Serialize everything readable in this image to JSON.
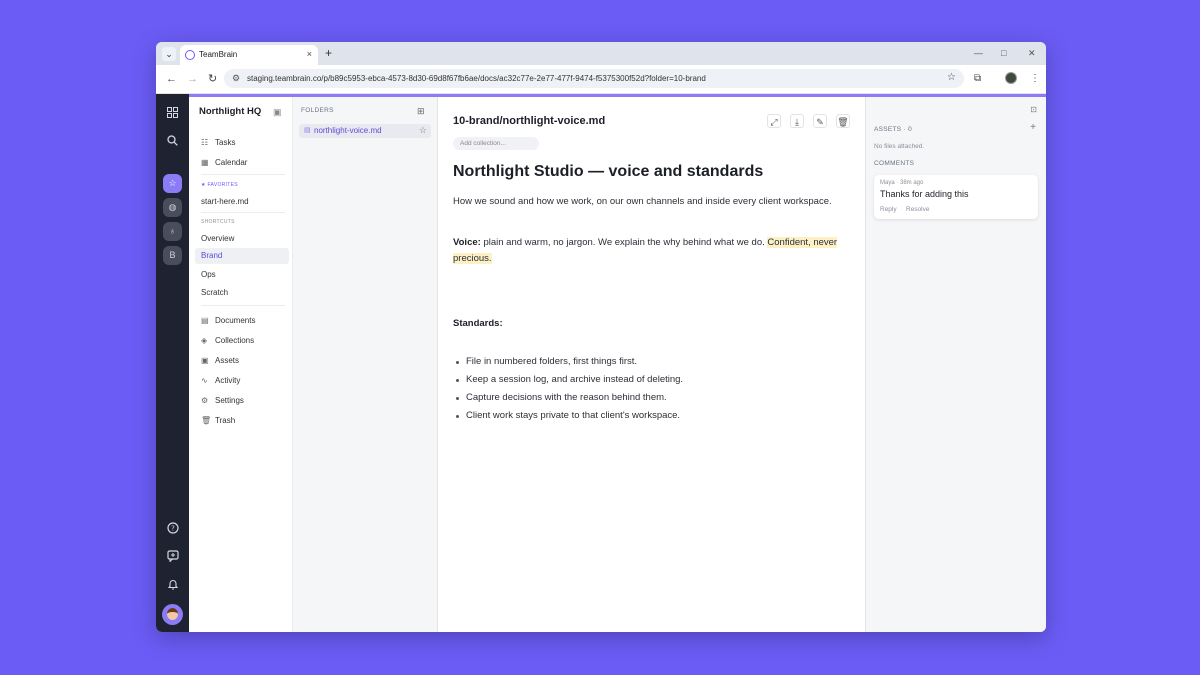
{
  "browser": {
    "tab_title": "TeamBrain",
    "tab_close": "×",
    "new_tab": "+",
    "tab_menu": "⌄",
    "url": "staging.teambrain.co/p/b89c5953-ebca-4573-8d30-69d8f67fb6ae/docs/ac32c77e-2e77-477f-9474-f5375300f52d?folder=10-brand",
    "back": "←",
    "forward": "→",
    "reload": "↻",
    "minimize": "—",
    "maximize": "□",
    "close": "✕",
    "site_info": "⚙",
    "bookmark": "☆",
    "extensions": "⧉",
    "menu": "⋮"
  },
  "rail": {
    "icons": [
      "grid-icon",
      "search-icon",
      "help-icon",
      "feedback-icon",
      "bell-icon"
    ],
    "workspaces": [
      {
        "glyph": "☆",
        "active": true
      },
      {
        "glyph": "◍",
        "active": false
      },
      {
        "glyph": "♁",
        "active": false
      },
      {
        "glyph": "B",
        "active": false
      }
    ]
  },
  "sidebar": {
    "workspace_title": "Northlight HQ",
    "top_items": [
      {
        "icon": "☷",
        "label": "Tasks"
      },
      {
        "icon": "▦",
        "label": "Calendar"
      }
    ],
    "favorites_label": "★ FAVORITES",
    "favorites": [
      "start-here.md"
    ],
    "shortcuts_label": "SHORTCUTS",
    "shortcuts": [
      "Overview",
      "Brand",
      "Ops",
      "Scratch"
    ],
    "active_shortcut": "Brand",
    "bottom_items": [
      {
        "icon": "▤",
        "label": "Documents"
      },
      {
        "icon": "◈",
        "label": "Collections"
      },
      {
        "icon": "▣",
        "label": "Assets"
      },
      {
        "icon": "∿",
        "label": "Activity"
      },
      {
        "icon": "⚙",
        "label": "Settings"
      },
      {
        "icon": "🗑",
        "label": "Trash"
      }
    ]
  },
  "folders": {
    "title": "FOLDERS",
    "files": [
      {
        "name": "northlight-voice.md",
        "active": true
      }
    ]
  },
  "doc": {
    "path": "10-brand/northlight-voice.md",
    "add_collection_placeholder": "Add collection...",
    "title": "Northlight Studio — voice and standards",
    "intro": "How we sound and how we work, on our own channels and inside every client workspace.",
    "voice_label": "Voice:",
    "voice_text": " plain and warm, no jargon. We explain the why behind what we do. ",
    "voice_highlight": "Confident, never precious.",
    "standards_label": "Standards:",
    "standards": [
      "File in numbered folders, first things first.",
      "Keep a session log, and archive instead of deleting.",
      "Capture decisions with the reason behind them.",
      "Client work stays private to that client's workspace."
    ]
  },
  "panel": {
    "assets_label": "ASSETS · 0",
    "no_files": "No files attached.",
    "comments_label": "COMMENTS",
    "comments": [
      {
        "meta": "Maya · 38m ago",
        "text": "Thanks for adding this",
        "reply": "Reply",
        "resolve": "Resolve"
      }
    ]
  }
}
